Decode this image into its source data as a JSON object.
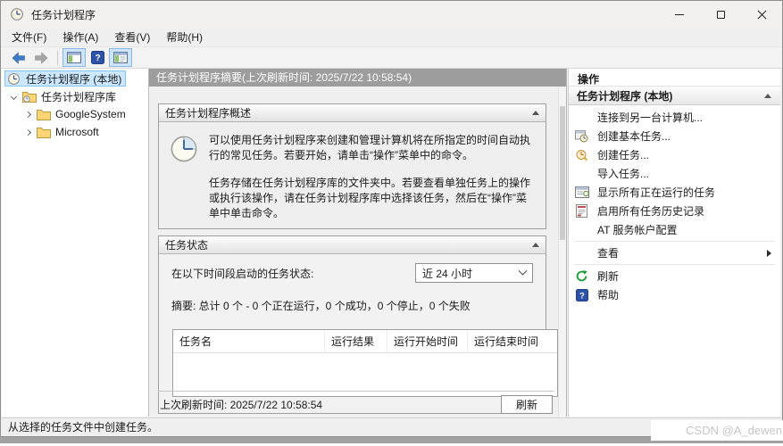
{
  "window": {
    "title": "任务计划程序"
  },
  "menu": {
    "file": "文件(F)",
    "action": "操作(A)",
    "view": "查看(V)",
    "help": "帮助(H)"
  },
  "tree": {
    "root": "任务计划程序 (本地)",
    "library": "任务计划程序库",
    "folders": [
      {
        "name": "GoogleSystem"
      },
      {
        "name": "Microsoft"
      }
    ]
  },
  "summary": {
    "header": "任务计划程序摘要(上次刷新时间: 2025/7/22 10:58:54)",
    "overview_title": "任务计划程序概述",
    "overview_p1": "可以使用任务计划程序来创建和管理计算机将在所指定的时间自动执行的常见任务。若要开始，请单击“操作”菜单中的命令。",
    "overview_p2": "任务存储在任务计划程序库的文件夹中。若要查看单独任务上的操作或执行该操作，请在任务计划程序库中选择该任务，然后在“操作”菜单中单击命令。",
    "status_title": "任务状态",
    "period_label": "在以下时间段启动的任务状态:",
    "period_value": "近 24 小时",
    "summary_line": "摘要: 总计 0 个 - 0 个正在运行，0 个成功，0 个停止，0 个失败",
    "table_headers": [
      "任务名",
      "运行结果",
      "运行开始时间",
      "运行结束时间"
    ],
    "last_refresh": "上次刷新时间: 2025/7/22 10:58:54",
    "refresh_button": "刷新"
  },
  "actions": {
    "panel_title": "操作",
    "group_title": "任务计划程序 (本地)",
    "items": [
      {
        "label": "连接到另一台计算机...",
        "icon": "none"
      },
      {
        "label": "创建基本任务...",
        "icon": "basic-task-icon"
      },
      {
        "label": "创建任务...",
        "icon": "create-task-icon"
      },
      {
        "label": "导入任务...",
        "icon": "none"
      },
      {
        "label": "显示所有正在运行的任务",
        "icon": "running-tasks-icon"
      },
      {
        "label": "启用所有任务历史记录",
        "icon": "task-history-icon"
      },
      {
        "label": "AT 服务帐户配置",
        "icon": "none"
      },
      {
        "label": "查看",
        "icon": "none",
        "submenu": true
      },
      {
        "label": "刷新",
        "icon": "refresh-icon"
      },
      {
        "label": "帮助",
        "icon": "help-icon"
      }
    ]
  },
  "statusbar": {
    "text": "从选择的任务文件中创建任务。"
  },
  "watermark": "CSDN @A_dewen",
  "icons": {
    "app-icon": "clock",
    "back-icon": "blue left arrow",
    "forward-icon": "gray right arrow",
    "console-tree-toggle-icon": "window with left pane",
    "help-toolbar-icon": "blue square question mark",
    "action-pane-toggle-icon": "window with side pane",
    "folder-icon": "yellow folder",
    "library-icon": "yellow folder with clock",
    "refresh-icon": "green circular arrow",
    "help-icon": "blue square question mark"
  },
  "colors": {
    "selection_bg": "#cce8ff",
    "selection_border": "#84c3f2",
    "center_header": "#9d9d9d",
    "folder_yellow": "#fcd575",
    "refresh_green": "#1f9d3a",
    "help_blue": "#2d52a8",
    "back_blue": "#3f7bc6"
  }
}
